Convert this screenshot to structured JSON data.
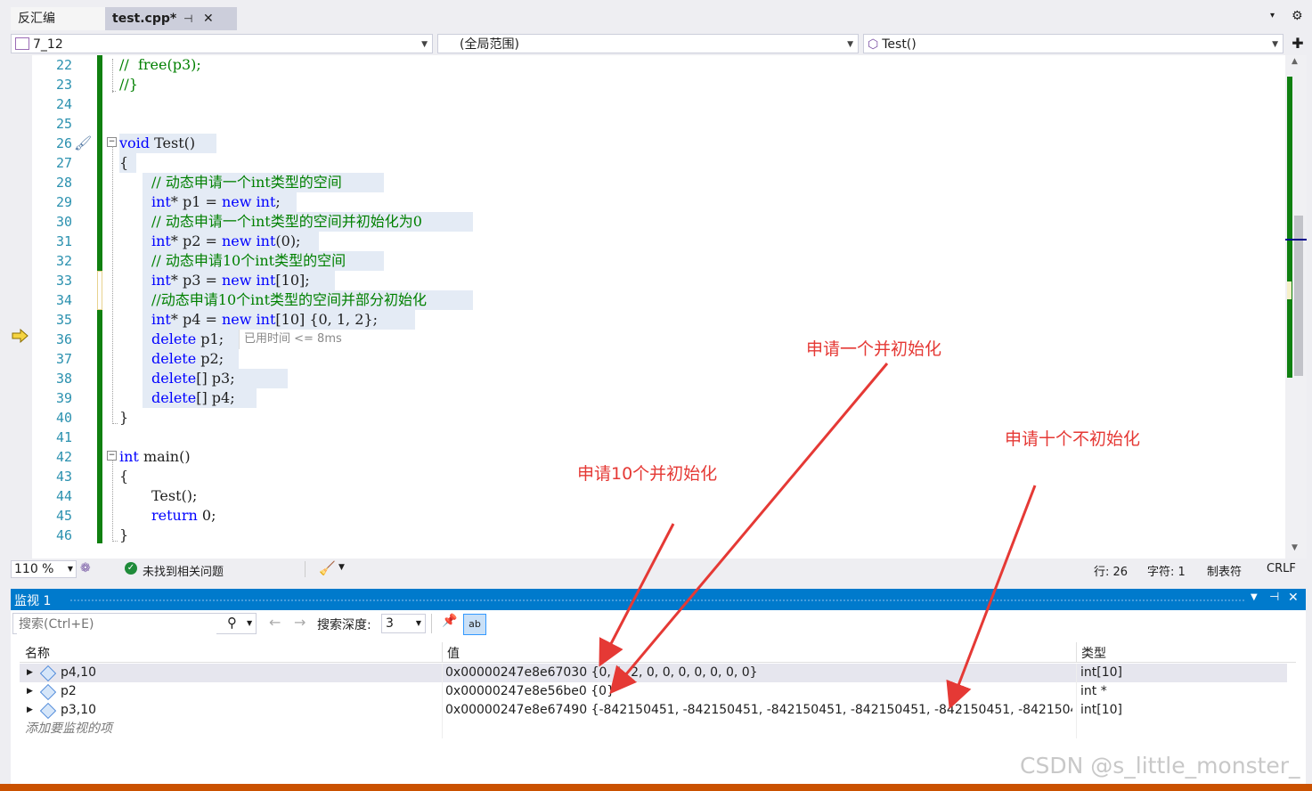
{
  "tabs": [
    {
      "label": "反汇编",
      "active": false
    },
    {
      "label": "test.cpp*",
      "active": true
    }
  ],
  "tab_pin": "⊣",
  "tab_close": "✕",
  "navbar": {
    "project": "7_12",
    "scope": "(全局范围)",
    "member": "Test()"
  },
  "code_lines": [
    {
      "n": "22",
      "text": "//  free(p3);"
    },
    {
      "n": "23",
      "text": "//}"
    },
    {
      "n": "24",
      "text": ""
    },
    {
      "n": "25",
      "text": ""
    },
    {
      "n": "26",
      "text": "void Test()"
    },
    {
      "n": "27",
      "text": "{"
    },
    {
      "n": "28",
      "text": "// 动态申请一个int类型的空间"
    },
    {
      "n": "29",
      "text": "int* p1 = new int;"
    },
    {
      "n": "30",
      "text": "// 动态申请一个int类型的空间并初始化为0"
    },
    {
      "n": "31",
      "text": "int* p2 = new int(0);"
    },
    {
      "n": "32",
      "text": "// 动态申请10个int类型的空间"
    },
    {
      "n": "33",
      "text": "int* p3 = new int[10];"
    },
    {
      "n": "34",
      "text": "//动态申请10个int类型的空间并部分初始化"
    },
    {
      "n": "35",
      "text": "int* p4 = new int[10] {0, 1, 2};"
    },
    {
      "n": "36",
      "text": "delete p1;"
    },
    {
      "n": "37",
      "text": "delete p2;"
    },
    {
      "n": "38",
      "text": "delete[] p3;"
    },
    {
      "n": "39",
      "text": "delete[] p4;"
    },
    {
      "n": "40",
      "text": "}"
    },
    {
      "n": "41",
      "text": ""
    },
    {
      "n": "42",
      "text": "int main()"
    },
    {
      "n": "43",
      "text": "{"
    },
    {
      "n": "44",
      "text": "Test();"
    },
    {
      "n": "45",
      "text": "return 0;"
    },
    {
      "n": "46",
      "text": "}"
    }
  ],
  "perf_tip": "已用时间 <= 8ms",
  "status": {
    "zoom": "110 %",
    "issues": "未找到相关问题",
    "line": "行: 26",
    "char": "字符: 1",
    "tabs": "制表符",
    "eol": "CRLF"
  },
  "watch": {
    "title": "监视 1",
    "search_placeholder": "搜索(Ctrl+E)",
    "search_depth_label": "搜索深度:",
    "search_depth_value": "3",
    "columns": {
      "name": "名称",
      "value": "值",
      "type": "类型"
    },
    "rows": [
      {
        "name": "p4,10",
        "value": "0x00000247e8e67030 {0, 1, 2, 0, 0, 0, 0, 0, 0, 0}",
        "type": "int[10]"
      },
      {
        "name": "p2",
        "value": "0x00000247e8e56be0 {0}",
        "type": "int *"
      },
      {
        "name": "p3,10",
        "value": "0x00000247e8e67490 {-842150451, -842150451, -842150451, -842150451, -842150451, -842150451, -842...",
        "type": "int[10]"
      }
    ],
    "add_item": "添加要监视的项"
  },
  "annotations": {
    "a1": "申请一个并初始化",
    "a2": "申请十个不初始化",
    "a3": "申请10个并初始化"
  },
  "watermark": "CSDN @s_little_monster_",
  "colors": {
    "accent": "#007acc",
    "annotation": "#e53935",
    "changed_margin": "#108010"
  }
}
